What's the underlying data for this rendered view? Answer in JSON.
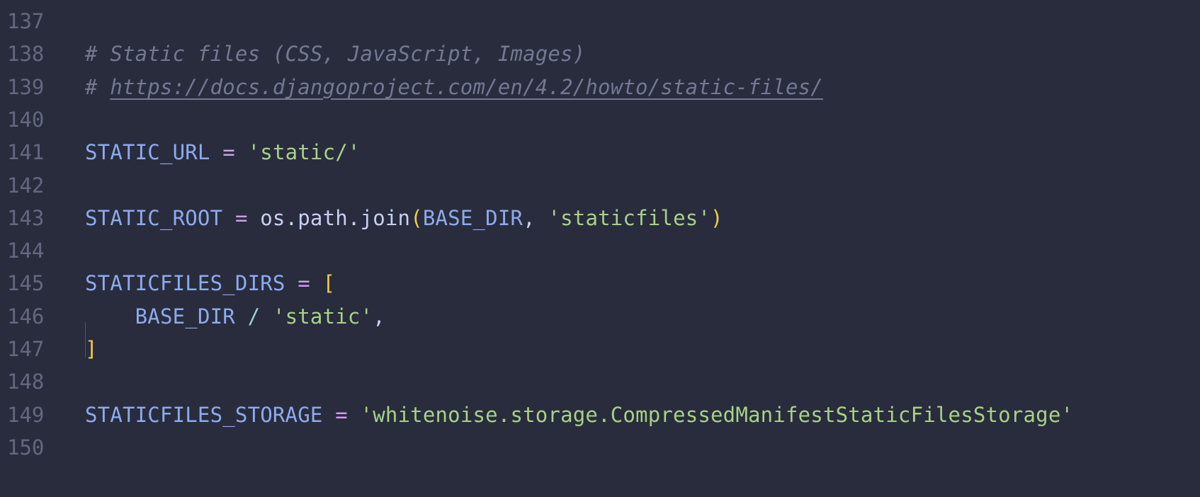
{
  "editor": {
    "lines": [
      {
        "number": "137",
        "tokens": []
      },
      {
        "number": "138",
        "tokens": [
          {
            "type": "comment",
            "text": "# Static files (CSS, JavaScript, Images)"
          }
        ]
      },
      {
        "number": "139",
        "tokens": [
          {
            "type": "comment",
            "text": "# "
          },
          {
            "type": "link",
            "text": "https://docs.djangoproject.com/en/4.2/howto/static-files/"
          }
        ]
      },
      {
        "number": "140",
        "tokens": []
      },
      {
        "number": "141",
        "tokens": [
          {
            "type": "var",
            "text": "STATIC_URL"
          },
          {
            "type": "plain",
            "text": " "
          },
          {
            "type": "op",
            "text": "="
          },
          {
            "type": "plain",
            "text": " "
          },
          {
            "type": "str",
            "text": "'static/'"
          }
        ]
      },
      {
        "number": "142",
        "tokens": []
      },
      {
        "number": "143",
        "tokens": [
          {
            "type": "var",
            "text": "STATIC_ROOT"
          },
          {
            "type": "plain",
            "text": " "
          },
          {
            "type": "op",
            "text": "="
          },
          {
            "type": "plain",
            "text": " os.path.join"
          },
          {
            "type": "bracket-gold",
            "text": "("
          },
          {
            "type": "var",
            "text": "BASE_DIR"
          },
          {
            "type": "punct",
            "text": ", "
          },
          {
            "type": "str",
            "text": "'staticfiles'"
          },
          {
            "type": "bracket-gold",
            "text": ")"
          }
        ]
      },
      {
        "number": "144",
        "tokens": []
      },
      {
        "number": "145",
        "tokens": [
          {
            "type": "var",
            "text": "STATICFILES_DIRS"
          },
          {
            "type": "plain",
            "text": " "
          },
          {
            "type": "op",
            "text": "="
          },
          {
            "type": "plain",
            "text": " "
          },
          {
            "type": "bracket-gold",
            "text": "["
          }
        ]
      },
      {
        "number": "146",
        "tokens": [
          {
            "type": "plain",
            "text": "    "
          },
          {
            "type": "var",
            "text": "BASE_DIR"
          },
          {
            "type": "plain",
            "text": " "
          },
          {
            "type": "slash",
            "text": "/"
          },
          {
            "type": "plain",
            "text": " "
          },
          {
            "type": "str",
            "text": "'static'"
          },
          {
            "type": "punct",
            "text": ","
          }
        ]
      },
      {
        "number": "147",
        "tokens": [
          {
            "type": "bracket-gold",
            "text": "]"
          }
        ]
      },
      {
        "number": "148",
        "tokens": []
      },
      {
        "number": "149",
        "tokens": [
          {
            "type": "var",
            "text": "STATICFILES_STORAGE"
          },
          {
            "type": "plain",
            "text": " "
          },
          {
            "type": "op",
            "text": "="
          },
          {
            "type": "plain",
            "text": " "
          },
          {
            "type": "str",
            "text": "'whitenoise.storage.CompressedManifestStaticFilesStorage'"
          }
        ]
      },
      {
        "number": "150",
        "tokens": []
      }
    ]
  },
  "colors": {
    "background": "#292c3c",
    "gutter": "#626880",
    "variable": "#8caaee",
    "operator": "#ca9ee6",
    "string": "#a6d189",
    "bracket": "#f2c94c",
    "comment": "#737994"
  }
}
